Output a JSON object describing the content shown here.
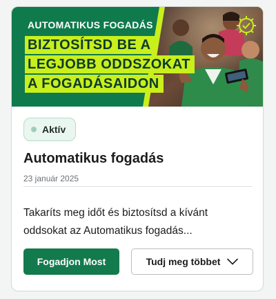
{
  "banner": {
    "eyebrow": "AUTOMATIKUS FOGADÁS",
    "headline_lines": [
      "BIZTOSÍTSD BE A",
      "LEGJOBB ODDSZOKAT",
      "A FOGADÁSAIDON"
    ],
    "colors": {
      "background": "#0f7a4c",
      "highlight": "#c9ef1d",
      "headline_text": "#0d3b2b"
    },
    "badge_icon": "gear-check-icon"
  },
  "status": {
    "label": "Aktív",
    "icon": "status-dot-icon",
    "color": "#9fd0b7"
  },
  "article": {
    "title": "Automatikus fogadás",
    "date": "23 január 2025",
    "description": "Takaríts meg időt és biztosítsd a kívánt oddsokat az Automatikus fogadás..."
  },
  "actions": {
    "primary_label": "Fogadjon Most",
    "secondary_label": "Tudj meg többet",
    "secondary_icon": "chevron-down-icon",
    "primary_color": "#137a4d"
  }
}
